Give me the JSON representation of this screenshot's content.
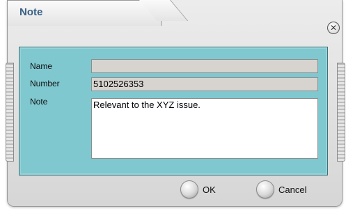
{
  "dialog": {
    "title": "Note",
    "close_icon": "close-icon"
  },
  "form": {
    "name_label": "Name",
    "name_value": "",
    "number_label": "Number",
    "number_value": "5102526353",
    "note_label": "Note",
    "note_value": "Relevant to the XYZ issue."
  },
  "buttons": {
    "ok_label": "OK",
    "cancel_label": "Cancel"
  },
  "colors": {
    "title": "#3a5f86",
    "panel": "#7fc8d0",
    "readonly_field": "#d7d3cf"
  }
}
